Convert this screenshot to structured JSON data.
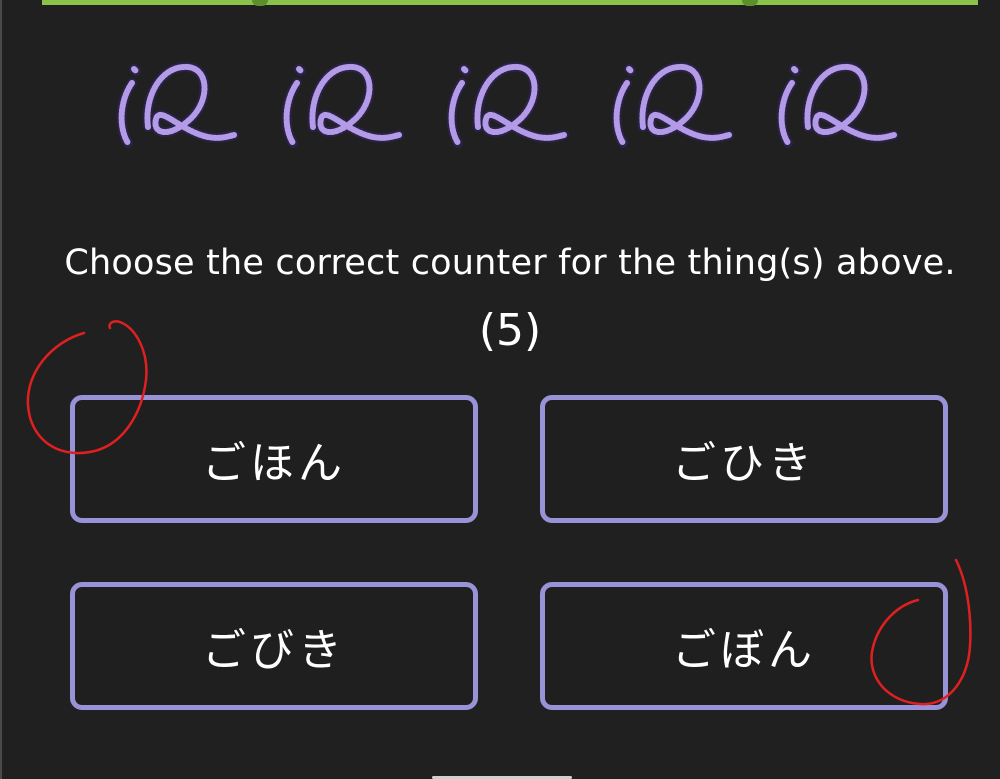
{
  "question": {
    "prompt": "Choose the correct counter for the thing(s) above.",
    "count_label": "(5)",
    "item_icon": "rope-icon",
    "item_count": 5
  },
  "options": [
    {
      "label": "ごほん"
    },
    {
      "label": "ごひき"
    },
    {
      "label": "ごびき"
    },
    {
      "label": "ごぼん"
    }
  ],
  "colors": {
    "background": "#202020",
    "option_border": "#9893d6",
    "progress_bar": "#8bc34a",
    "rope": "#b49be8",
    "annotation": "#e02020"
  }
}
